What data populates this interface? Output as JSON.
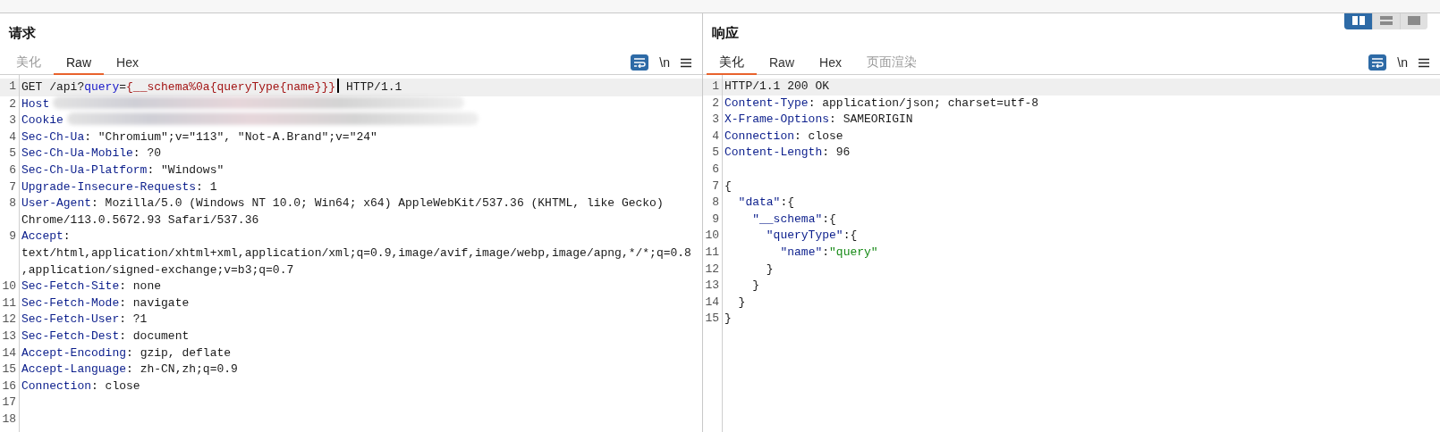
{
  "view_toggle": [
    {
      "kind": "columns",
      "selected": true
    },
    {
      "kind": "rows",
      "selected": false
    },
    {
      "kind": "single",
      "selected": false
    }
  ],
  "panes": [
    {
      "title": "请求",
      "tabs": [
        {
          "label": "美化",
          "selected": false,
          "disabled": true
        },
        {
          "label": "Raw",
          "selected": true,
          "disabled": false
        },
        {
          "label": "Hex",
          "selected": false,
          "disabled": false
        }
      ],
      "wrap_on": true,
      "newline_label": "\\n",
      "lines": [
        {
          "number": "1",
          "current": true,
          "segments": [
            {
              "kind": "plain",
              "text": "GET /api?"
            },
            {
              "kind": "param",
              "text": "query"
            },
            {
              "kind": "plain",
              "text": "="
            },
            {
              "kind": "payload",
              "text": "{__schema%0a{queryType{name}}}"
            },
            {
              "kind": "cursor"
            },
            {
              "kind": "plain",
              "text": " HTTP/1.1"
            }
          ]
        },
        {
          "number": "2",
          "current": false,
          "redacted": true,
          "segments": [
            {
              "kind": "key",
              "text": "Host"
            }
          ]
        },
        {
          "number": "3",
          "current": false,
          "redacted": true,
          "segments": [
            {
              "kind": "key",
              "text": "Cookie"
            }
          ]
        },
        {
          "number": "4",
          "current": false,
          "segments": [
            {
              "kind": "key",
              "text": "Sec-Ch-Ua"
            },
            {
              "kind": "plain",
              "text": ": \"Chromium\";v=\"113\", \"Not-A.Brand\";v=\"24\""
            }
          ]
        },
        {
          "number": "5",
          "current": false,
          "segments": [
            {
              "kind": "key",
              "text": "Sec-Ch-Ua-Mobile"
            },
            {
              "kind": "plain",
              "text": ": ?0"
            }
          ]
        },
        {
          "number": "6",
          "current": false,
          "segments": [
            {
              "kind": "key",
              "text": "Sec-Ch-Ua-Platform"
            },
            {
              "kind": "plain",
              "text": ": \"Windows\""
            }
          ]
        },
        {
          "number": "7",
          "current": false,
          "segments": [
            {
              "kind": "key",
              "text": "Upgrade-Insecure-Requests"
            },
            {
              "kind": "plain",
              "text": ": 1"
            }
          ]
        },
        {
          "number": "8",
          "current": false,
          "segments": [
            {
              "kind": "key",
              "text": "User-Agent"
            },
            {
              "kind": "plain",
              "text": ": Mozilla/5.0 (Windows NT 10.0; Win64; x64) AppleWebKit/537.36 (KHTML, like Gecko) Chrome/113.0.5672.93 Safari/537.36"
            }
          ]
        },
        {
          "number": "9",
          "current": false,
          "segments": [
            {
              "kind": "key",
              "text": "Accept"
            },
            {
              "kind": "plain",
              "text": ": text/html,application/xhtml+xml,application/xml;q=0.9,image/avif,image/webp,image/apng,*/*;q=0.8,application/signed-exchange;v=b3;q=0.7"
            }
          ]
        },
        {
          "number": "10",
          "current": false,
          "segments": [
            {
              "kind": "key",
              "text": "Sec-Fetch-Site"
            },
            {
              "kind": "plain",
              "text": ": none"
            }
          ]
        },
        {
          "number": "11",
          "current": false,
          "segments": [
            {
              "kind": "key",
              "text": "Sec-Fetch-Mode"
            },
            {
              "kind": "plain",
              "text": ": navigate"
            }
          ]
        },
        {
          "number": "12",
          "current": false,
          "segments": [
            {
              "kind": "key",
              "text": "Sec-Fetch-User"
            },
            {
              "kind": "plain",
              "text": ": ?1"
            }
          ]
        },
        {
          "number": "13",
          "current": false,
          "segments": [
            {
              "kind": "key",
              "text": "Sec-Fetch-Dest"
            },
            {
              "kind": "plain",
              "text": ": document"
            }
          ]
        },
        {
          "number": "14",
          "current": false,
          "segments": [
            {
              "kind": "key",
              "text": "Accept-Encoding"
            },
            {
              "kind": "plain",
              "text": ": gzip, deflate"
            }
          ]
        },
        {
          "number": "15",
          "current": false,
          "segments": [
            {
              "kind": "key",
              "text": "Accept-Language"
            },
            {
              "kind": "plain",
              "text": ": zh-CN,zh;q=0.9"
            }
          ]
        },
        {
          "number": "16",
          "current": false,
          "segments": [
            {
              "kind": "key",
              "text": "Connection"
            },
            {
              "kind": "plain",
              "text": ": close"
            }
          ]
        },
        {
          "number": "17",
          "current": false
        },
        {
          "number": "18",
          "current": false
        }
      ]
    },
    {
      "title": "响应",
      "tabs": [
        {
          "label": "美化",
          "selected": true,
          "disabled": false
        },
        {
          "label": "Raw",
          "selected": false,
          "disabled": false
        },
        {
          "label": "Hex",
          "selected": false,
          "disabled": false
        },
        {
          "label": "页面渲染",
          "selected": false,
          "disabled": true
        }
      ],
      "wrap_on": true,
      "newline_label": "\\n",
      "lines": [
        {
          "number": "1",
          "current": true,
          "segments": [
            {
              "kind": "plain",
              "text": "HTTP/1.1 200 OK"
            }
          ]
        },
        {
          "number": "2",
          "current": false,
          "segments": [
            {
              "kind": "key",
              "text": "Content-Type"
            },
            {
              "kind": "plain",
              "text": ": application/json; charset=utf-8"
            }
          ]
        },
        {
          "number": "3",
          "current": false,
          "segments": [
            {
              "kind": "key",
              "text": "X-Frame-Options"
            },
            {
              "kind": "plain",
              "text": ": SAMEORIGIN"
            }
          ]
        },
        {
          "number": "4",
          "current": false,
          "segments": [
            {
              "kind": "key",
              "text": "Connection"
            },
            {
              "kind": "plain",
              "text": ": close"
            }
          ]
        },
        {
          "number": "5",
          "current": false,
          "segments": [
            {
              "kind": "key",
              "text": "Content-Length"
            },
            {
              "kind": "plain",
              "text": ": 96"
            }
          ]
        },
        {
          "number": "6",
          "current": false
        },
        {
          "number": "7",
          "current": false,
          "segments": [
            {
              "kind": "plain",
              "text": "{"
            }
          ]
        },
        {
          "number": "8",
          "current": false,
          "segments": [
            {
              "kind": "key",
              "text": "  \"data\""
            },
            {
              "kind": "plain",
              "text": ":{"
            }
          ]
        },
        {
          "number": "9",
          "current": false,
          "segments": [
            {
              "kind": "key",
              "text": "    \"__schema\""
            },
            {
              "kind": "plain",
              "text": ":{"
            }
          ]
        },
        {
          "number": "10",
          "current": false,
          "segments": [
            {
              "kind": "key",
              "text": "      \"queryType\""
            },
            {
              "kind": "plain",
              "text": ":{"
            }
          ]
        },
        {
          "number": "11",
          "current": false,
          "segments": [
            {
              "kind": "key",
              "text": "        \"name\""
            },
            {
              "kind": "plain",
              "text": ":"
            },
            {
              "kind": "string",
              "text": "\"query\""
            }
          ]
        },
        {
          "number": "12",
          "current": false,
          "segments": [
            {
              "kind": "plain",
              "text": "      }"
            }
          ]
        },
        {
          "number": "13",
          "current": false,
          "segments": [
            {
              "kind": "plain",
              "text": "    }"
            }
          ]
        },
        {
          "number": "14",
          "current": false,
          "segments": [
            {
              "kind": "plain",
              "text": "  }"
            }
          ]
        },
        {
          "number": "15",
          "current": false,
          "segments": [
            {
              "kind": "plain",
              "text": "}"
            }
          ]
        }
      ]
    }
  ]
}
